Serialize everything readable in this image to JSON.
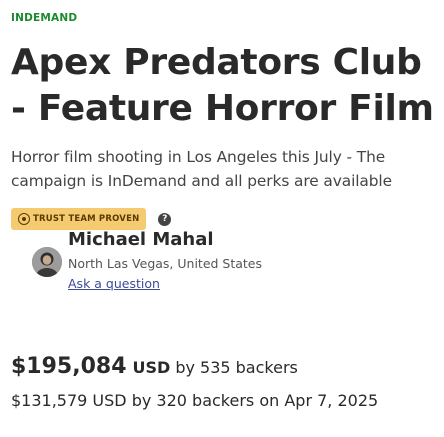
{
  "campaign": {
    "tag": "INDEMAND",
    "title": "Apex Predators Club - Feature Horror Film",
    "subtitle": "Horror film shooting in Los Angeles this July - The campaign is InDemand and all perks are available"
  },
  "trust": {
    "badge_label": "TRUST TEAM PROVEN",
    "help_glyph": "?",
    "badge_color": "#f5cb72"
  },
  "owner": {
    "name": "Michael Mahal",
    "location": "North Las Vegas, United States",
    "ask_label": "Ask a question"
  },
  "funding": {
    "amount": "$195,084",
    "currency": "USD",
    "backers_text": "by 535 backers",
    "previous": "$131,579 USD by 320 backers on Apr 7, 2025"
  },
  "colors": {
    "accent_green": "#198a2e",
    "link": "#3d4a9a"
  }
}
